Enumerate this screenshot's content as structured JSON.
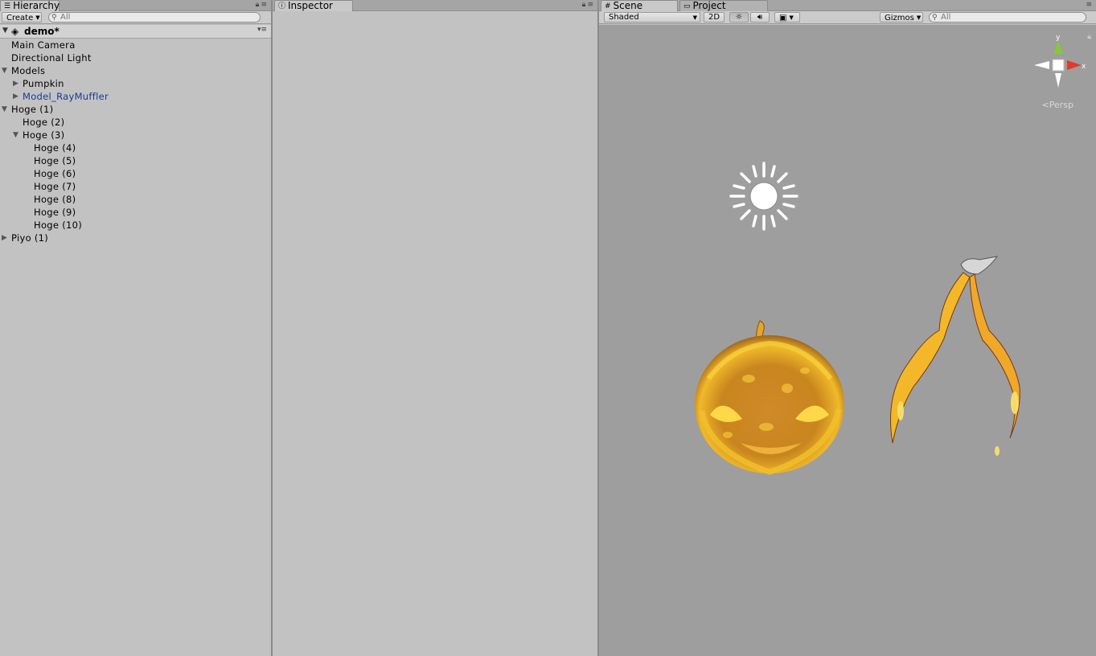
{
  "hierarchy": {
    "tab_label": "Hierarchy",
    "create_label": "Create",
    "search_placeholder": "All",
    "scene_name": "demo*",
    "rows": [
      {
        "label": "Main Camera",
        "depth": 1,
        "arrow": "",
        "prefab": false
      },
      {
        "label": "Directional Light",
        "depth": 1,
        "arrow": "",
        "prefab": false
      },
      {
        "label": "Models",
        "depth": 1,
        "arrow": "down",
        "prefab": false
      },
      {
        "label": "Pumpkin",
        "depth": 2,
        "arrow": "right",
        "prefab": false
      },
      {
        "label": "Model_RayMuffler",
        "depth": 2,
        "arrow": "right",
        "prefab": true
      },
      {
        "label": "Hoge (1)",
        "depth": 1,
        "arrow": "down",
        "prefab": false
      },
      {
        "label": "Hoge (2)",
        "depth": 2,
        "arrow": "",
        "prefab": false
      },
      {
        "label": "Hoge (3)",
        "depth": 2,
        "arrow": "down",
        "prefab": false
      },
      {
        "label": "Hoge (4)",
        "depth": 3,
        "arrow": "",
        "prefab": false
      },
      {
        "label": "Hoge (5)",
        "depth": 3,
        "arrow": "",
        "prefab": false
      },
      {
        "label": "Hoge (6)",
        "depth": 3,
        "arrow": "",
        "prefab": false
      },
      {
        "label": "Hoge (7)",
        "depth": 3,
        "arrow": "",
        "prefab": false
      },
      {
        "label": "Hoge (8)",
        "depth": 3,
        "arrow": "",
        "prefab": false
      },
      {
        "label": "Hoge (9)",
        "depth": 3,
        "arrow": "",
        "prefab": false
      },
      {
        "label": "Hoge (10)",
        "depth": 3,
        "arrow": "",
        "prefab": false
      },
      {
        "label": "Piyo (1)",
        "depth": 1,
        "arrow": "right",
        "prefab": false
      }
    ]
  },
  "inspector": {
    "tab_label": "Inspector"
  },
  "scene_view": {
    "tab_scene": "Scene",
    "tab_project": "Project",
    "shading_mode": "Shaded",
    "toggle_2d": "2D",
    "gizmos_label": "Gizmos",
    "search_placeholder": "All",
    "projection_label": "Persp",
    "gizmo_axes": {
      "y": "y",
      "x": "x"
    }
  },
  "colors": {
    "panel_bg": "#c2c2c2",
    "viewport_bg": "#9e9e9e",
    "prefab_text": "#1b3a8f",
    "axis_x": "#e23b2a",
    "axis_y": "#86c73a"
  }
}
